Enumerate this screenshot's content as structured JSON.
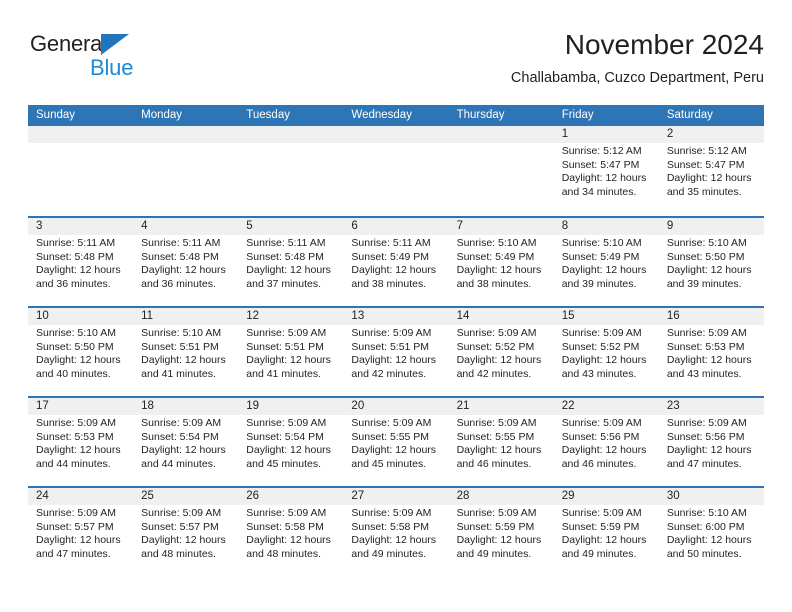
{
  "brand": {
    "name_top": "General",
    "name_bottom": "Blue",
    "triangle_color": "#1f76bc",
    "blue_text_color": "#1f8ad6"
  },
  "header": {
    "title": "November 2024",
    "subtitle": "Challabamba, Cuzco Department, Peru"
  },
  "theme": {
    "header_band": "#2e75b6",
    "daynum_band": "#f0f0f0",
    "text": "#231f20"
  },
  "weekdays": [
    "Sunday",
    "Monday",
    "Tuesday",
    "Wednesday",
    "Thursday",
    "Friday",
    "Saturday"
  ],
  "weeks": [
    [
      {
        "day": "",
        "lines": [
          "",
          "",
          "",
          ""
        ]
      },
      {
        "day": "",
        "lines": [
          "",
          "",
          "",
          ""
        ]
      },
      {
        "day": "",
        "lines": [
          "",
          "",
          "",
          ""
        ]
      },
      {
        "day": "",
        "lines": [
          "",
          "",
          "",
          ""
        ]
      },
      {
        "day": "",
        "lines": [
          "",
          "",
          "",
          ""
        ]
      },
      {
        "day": "1",
        "lines": [
          "Sunrise: 5:12 AM",
          "Sunset: 5:47 PM",
          "Daylight: 12 hours",
          "and 34 minutes."
        ]
      },
      {
        "day": "2",
        "lines": [
          "Sunrise: 5:12 AM",
          "Sunset: 5:47 PM",
          "Daylight: 12 hours",
          "and 35 minutes."
        ]
      }
    ],
    [
      {
        "day": "3",
        "lines": [
          "Sunrise: 5:11 AM",
          "Sunset: 5:48 PM",
          "Daylight: 12 hours",
          "and 36 minutes."
        ]
      },
      {
        "day": "4",
        "lines": [
          "Sunrise: 5:11 AM",
          "Sunset: 5:48 PM",
          "Daylight: 12 hours",
          "and 36 minutes."
        ]
      },
      {
        "day": "5",
        "lines": [
          "Sunrise: 5:11 AM",
          "Sunset: 5:48 PM",
          "Daylight: 12 hours",
          "and 37 minutes."
        ]
      },
      {
        "day": "6",
        "lines": [
          "Sunrise: 5:11 AM",
          "Sunset: 5:49 PM",
          "Daylight: 12 hours",
          "and 38 minutes."
        ]
      },
      {
        "day": "7",
        "lines": [
          "Sunrise: 5:10 AM",
          "Sunset: 5:49 PM",
          "Daylight: 12 hours",
          "and 38 minutes."
        ]
      },
      {
        "day": "8",
        "lines": [
          "Sunrise: 5:10 AM",
          "Sunset: 5:49 PM",
          "Daylight: 12 hours",
          "and 39 minutes."
        ]
      },
      {
        "day": "9",
        "lines": [
          "Sunrise: 5:10 AM",
          "Sunset: 5:50 PM",
          "Daylight: 12 hours",
          "and 39 minutes."
        ]
      }
    ],
    [
      {
        "day": "10",
        "lines": [
          "Sunrise: 5:10 AM",
          "Sunset: 5:50 PM",
          "Daylight: 12 hours",
          "and 40 minutes."
        ]
      },
      {
        "day": "11",
        "lines": [
          "Sunrise: 5:10 AM",
          "Sunset: 5:51 PM",
          "Daylight: 12 hours",
          "and 41 minutes."
        ]
      },
      {
        "day": "12",
        "lines": [
          "Sunrise: 5:09 AM",
          "Sunset: 5:51 PM",
          "Daylight: 12 hours",
          "and 41 minutes."
        ]
      },
      {
        "day": "13",
        "lines": [
          "Sunrise: 5:09 AM",
          "Sunset: 5:51 PM",
          "Daylight: 12 hours",
          "and 42 minutes."
        ]
      },
      {
        "day": "14",
        "lines": [
          "Sunrise: 5:09 AM",
          "Sunset: 5:52 PM",
          "Daylight: 12 hours",
          "and 42 minutes."
        ]
      },
      {
        "day": "15",
        "lines": [
          "Sunrise: 5:09 AM",
          "Sunset: 5:52 PM",
          "Daylight: 12 hours",
          "and 43 minutes."
        ]
      },
      {
        "day": "16",
        "lines": [
          "Sunrise: 5:09 AM",
          "Sunset: 5:53 PM",
          "Daylight: 12 hours",
          "and 43 minutes."
        ]
      }
    ],
    [
      {
        "day": "17",
        "lines": [
          "Sunrise: 5:09 AM",
          "Sunset: 5:53 PM",
          "Daylight: 12 hours",
          "and 44 minutes."
        ]
      },
      {
        "day": "18",
        "lines": [
          "Sunrise: 5:09 AM",
          "Sunset: 5:54 PM",
          "Daylight: 12 hours",
          "and 44 minutes."
        ]
      },
      {
        "day": "19",
        "lines": [
          "Sunrise: 5:09 AM",
          "Sunset: 5:54 PM",
          "Daylight: 12 hours",
          "and 45 minutes."
        ]
      },
      {
        "day": "20",
        "lines": [
          "Sunrise: 5:09 AM",
          "Sunset: 5:55 PM",
          "Daylight: 12 hours",
          "and 45 minutes."
        ]
      },
      {
        "day": "21",
        "lines": [
          "Sunrise: 5:09 AM",
          "Sunset: 5:55 PM",
          "Daylight: 12 hours",
          "and 46 minutes."
        ]
      },
      {
        "day": "22",
        "lines": [
          "Sunrise: 5:09 AM",
          "Sunset: 5:56 PM",
          "Daylight: 12 hours",
          "and 46 minutes."
        ]
      },
      {
        "day": "23",
        "lines": [
          "Sunrise: 5:09 AM",
          "Sunset: 5:56 PM",
          "Daylight: 12 hours",
          "and 47 minutes."
        ]
      }
    ],
    [
      {
        "day": "24",
        "lines": [
          "Sunrise: 5:09 AM",
          "Sunset: 5:57 PM",
          "Daylight: 12 hours",
          "and 47 minutes."
        ]
      },
      {
        "day": "25",
        "lines": [
          "Sunrise: 5:09 AM",
          "Sunset: 5:57 PM",
          "Daylight: 12 hours",
          "and 48 minutes."
        ]
      },
      {
        "day": "26",
        "lines": [
          "Sunrise: 5:09 AM",
          "Sunset: 5:58 PM",
          "Daylight: 12 hours",
          "and 48 minutes."
        ]
      },
      {
        "day": "27",
        "lines": [
          "Sunrise: 5:09 AM",
          "Sunset: 5:58 PM",
          "Daylight: 12 hours",
          "and 49 minutes."
        ]
      },
      {
        "day": "28",
        "lines": [
          "Sunrise: 5:09 AM",
          "Sunset: 5:59 PM",
          "Daylight: 12 hours",
          "and 49 minutes."
        ]
      },
      {
        "day": "29",
        "lines": [
          "Sunrise: 5:09 AM",
          "Sunset: 5:59 PM",
          "Daylight: 12 hours",
          "and 49 minutes."
        ]
      },
      {
        "day": "30",
        "lines": [
          "Sunrise: 5:10 AM",
          "Sunset: 6:00 PM",
          "Daylight: 12 hours",
          "and 50 minutes."
        ]
      }
    ]
  ]
}
